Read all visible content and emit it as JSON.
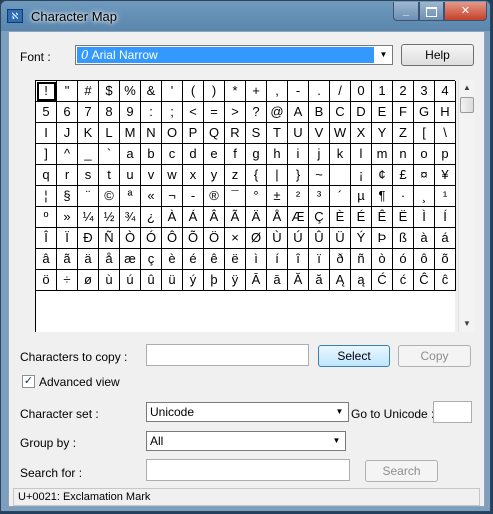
{
  "window": {
    "title": "Character Map",
    "icon_name": "charmap-app-icon",
    "icon_glyph": "ℵ"
  },
  "font": {
    "label": "Font :",
    "value": "Arial Narrow",
    "icon_glyph": "0",
    "help_label": "Help"
  },
  "grid": {
    "rows": [
      [
        "!",
        "\"",
        "#",
        "$",
        "%",
        "&",
        "'",
        "(",
        ")",
        "*",
        "+",
        ",",
        "-",
        ".",
        "/",
        "0",
        "1",
        "2",
        "3",
        "4"
      ],
      [
        "5",
        "6",
        "7",
        "8",
        "9",
        ":",
        ";",
        "<",
        "=",
        ">",
        "?",
        "@",
        "A",
        "B",
        "C",
        "D",
        "E",
        "F",
        "G",
        "H"
      ],
      [
        "I",
        "J",
        "K",
        "L",
        "M",
        "N",
        "O",
        "P",
        "Q",
        "R",
        "S",
        "T",
        "U",
        "V",
        "W",
        "X",
        "Y",
        "Z",
        "[",
        "\\"
      ],
      [
        "]",
        "^",
        "_",
        "`",
        "a",
        "b",
        "c",
        "d",
        "e",
        "f",
        "g",
        "h",
        "i",
        "j",
        "k",
        "l",
        "m",
        "n",
        "o",
        "p"
      ],
      [
        "q",
        "r",
        "s",
        "t",
        "u",
        "v",
        "w",
        "x",
        "y",
        "z",
        "{",
        "|",
        "}",
        "~",
        " ",
        "¡",
        "¢",
        "£",
        "¤",
        "¥"
      ],
      [
        "¦",
        "§",
        "¨",
        "©",
        "ª",
        "«",
        "¬",
        "-",
        "®",
        "¯",
        "°",
        "±",
        "²",
        "³",
        "´",
        "µ",
        "¶",
        "·",
        "¸",
        "¹"
      ],
      [
        "º",
        "»",
        "¼",
        "½",
        "¾",
        "¿",
        "À",
        "Á",
        "Â",
        "Ã",
        "Ä",
        "Å",
        "Æ",
        "Ç",
        "È",
        "É",
        "Ê",
        "Ë",
        "Ì",
        "Í"
      ],
      [
        "Î",
        "Ï",
        "Ð",
        "Ñ",
        "Ò",
        "Ó",
        "Ô",
        "Õ",
        "Ö",
        "×",
        "Ø",
        "Ù",
        "Ú",
        "Û",
        "Ü",
        "Ý",
        "Þ",
        "ß",
        "à",
        "á"
      ],
      [
        "â",
        "ã",
        "ä",
        "å",
        "æ",
        "ç",
        "è",
        "é",
        "ê",
        "ë",
        "ì",
        "í",
        "î",
        "ï",
        "ð",
        "ñ",
        "ò",
        "ó",
        "ô",
        "õ"
      ],
      [
        "ö",
        "÷",
        "ø",
        "ù",
        "ú",
        "û",
        "ü",
        "ý",
        "þ",
        "ÿ",
        "Ā",
        "ā",
        "Ă",
        "ă",
        "Ą",
        "ą",
        "Ć",
        "ć",
        "Ĉ",
        "ĉ"
      ]
    ],
    "selected": "!"
  },
  "copy": {
    "label": "Characters to copy :",
    "value": "",
    "select_label": "Select",
    "copy_label": "Copy"
  },
  "advanced": {
    "label": "Advanced view",
    "checked": true,
    "check_glyph": "✓"
  },
  "charset": {
    "label": "Character set :",
    "value": "Unicode"
  },
  "goto": {
    "label": "Go to Unicode :",
    "value": ""
  },
  "groupby": {
    "label": "Group by :",
    "value": "All"
  },
  "search": {
    "label": "Search for :",
    "value": "",
    "button_label": "Search"
  },
  "status": {
    "text": "U+0021: Exclamation Mark"
  },
  "colors": {
    "highlight": "#3399ff",
    "titlebar": "#5b86ad",
    "close_button": "#c64128"
  }
}
